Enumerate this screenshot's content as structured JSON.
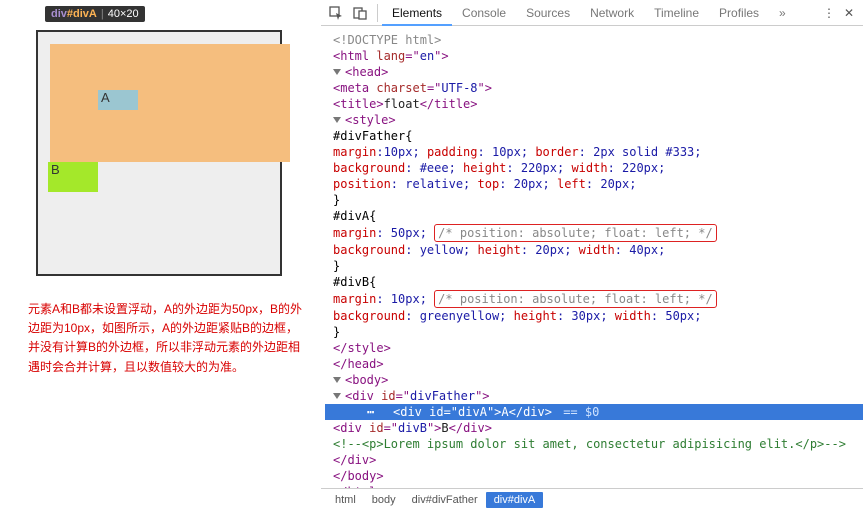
{
  "tooltip": {
    "tag": "div",
    "id": "#divA",
    "dims": "40×20"
  },
  "render": {
    "labelA": "A",
    "labelB": "B"
  },
  "note": "元素A和B都未设置浮动，A的外边距为50px，B的外边距为10px，如图所示，A的外边距紧贴B的边框，并没有计算B的外边框，所以非浮动元素的外边距相遇时会合并计算，且以数值较大的为准。",
  "toolbar": {
    "tabs": [
      "Elements",
      "Console",
      "Sources",
      "Network",
      "Timeline",
      "Profiles"
    ],
    "overflow": "»",
    "menu": "⋮",
    "close": "✕"
  },
  "tree": {
    "doctype": "<!DOCTYPE html>",
    "html_open": "<html lang=\"en\">",
    "head_open": "<head>",
    "meta": "<meta charset=\"UTF-8\">",
    "title_open": "<title>",
    "title_text": "float",
    "title_close": "</title>",
    "style_open": "<style>",
    "rule_father_sel": "#divFather{",
    "rule_father_l1_props": [
      "margin",
      "padding",
      "border"
    ],
    "rule_father_l1_vals": [
      ":10px; ",
      ": 10px; ",
      ": 2px solid #333;"
    ],
    "rule_father_l2_props": [
      "background",
      "height",
      "width"
    ],
    "rule_father_l2_vals": [
      ": #eee; ",
      ": 220px;  ",
      ": 220px;"
    ],
    "rule_father_l3_props": [
      "position",
      "top",
      "left"
    ],
    "rule_father_l3_vals": [
      ": relative; ",
      ": 20px; ",
      ": 20px;"
    ],
    "rule_close": "}",
    "rule_a_sel": "#divA{",
    "rule_a_l1_prop": "margin",
    "rule_a_l1_val": ": 50px;",
    "rule_a_comment": "/* position: absolute; float: left; */",
    "rule_a_l2_props": [
      "background",
      "height",
      "width"
    ],
    "rule_a_l2_vals": [
      ": yellow; ",
      ": 20px; ",
      ": 40px;"
    ],
    "rule_b_sel": "#divB{",
    "rule_b_l1_prop": "margin",
    "rule_b_l1_val": ": 10px;",
    "rule_b_comment": "/* position: absolute; float: left; */",
    "rule_b_l2_props": [
      "background",
      "height",
      "width"
    ],
    "rule_b_l2_vals": [
      ": greenyellow; ",
      ": 30px; ",
      ": 50px;"
    ],
    "style_close": "</style>",
    "head_close": "</head>",
    "body_open": "<body>",
    "divfather_open": "<div id=\"divFather\">",
    "diva_line": "<div id=\"divA\">A</div>",
    "diva_after": " == $0",
    "divb_line": "<div id=\"divB\">B</div>",
    "comment_p": "<!--<p>Lorem ipsum dolor sit amet, consectetur adipisicing elit.</p>-->",
    "divfather_close": "</div>",
    "body_close": "</body>",
    "html_close": "</html>"
  },
  "crumbs": [
    "html",
    "body",
    "div#divFather",
    "div#divA"
  ]
}
